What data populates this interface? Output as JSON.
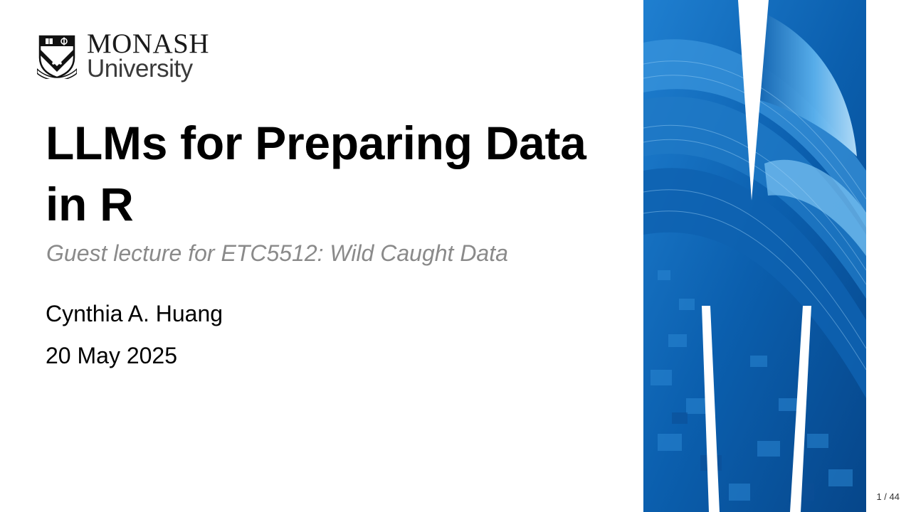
{
  "logo": {
    "line1": "MONASH",
    "line2": "University"
  },
  "slide": {
    "title": "LLMs for Preparing Data in R",
    "subtitle": "Guest lecture for ETC5512: Wild Caught Data",
    "author": "Cynthia A. Huang",
    "date": "20 May 2025",
    "page_number": "1 / 44"
  },
  "colors": {
    "accent_blue": "#0a5cab",
    "subtitle_gray": "#8a8a8a"
  },
  "icons": {
    "crest": "monash-crest-icon"
  }
}
